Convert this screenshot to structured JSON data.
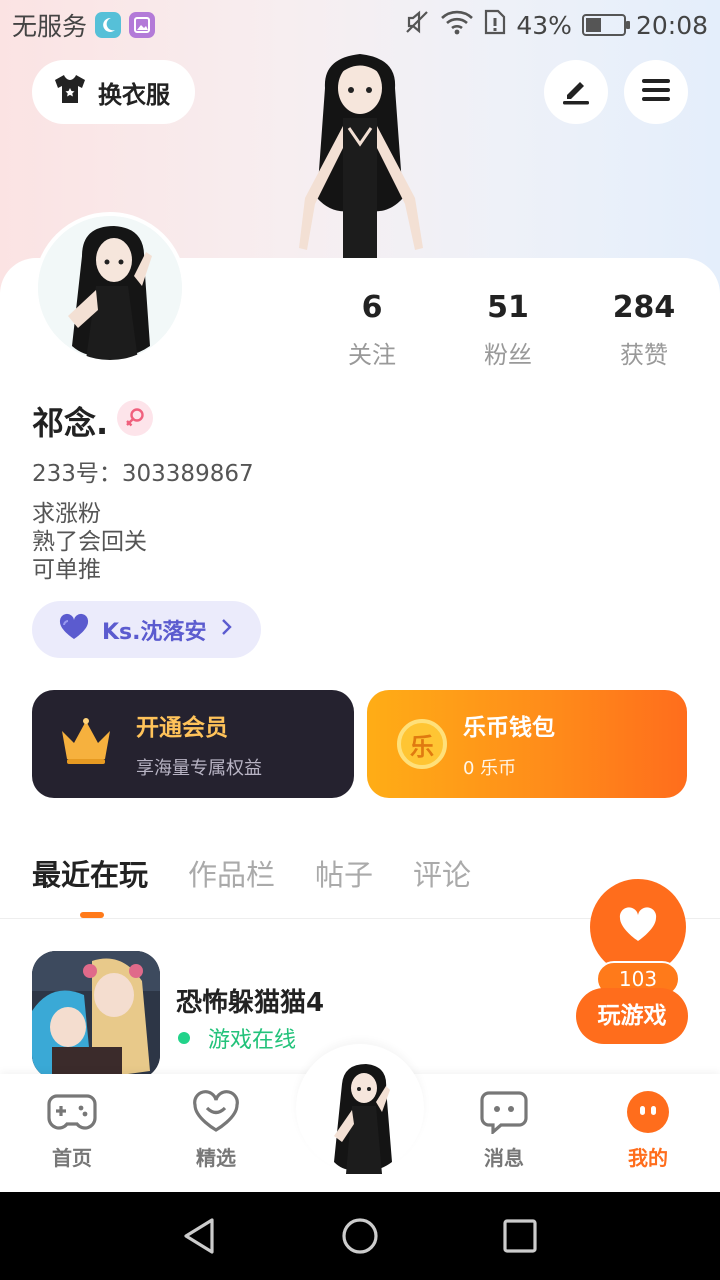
{
  "status_bar": {
    "carrier": "无服务",
    "battery": "43%",
    "battery_level": 0.43,
    "time": "20:08",
    "icons": [
      "moon-icon",
      "image-icon",
      "mute-icon",
      "wifi-icon",
      "sim-alert-icon",
      "battery-icon"
    ]
  },
  "header": {
    "outfit_label": "换衣服",
    "icons": [
      "shirt-icon",
      "edit-icon",
      "menu-icon"
    ]
  },
  "profile": {
    "stats": [
      {
        "value": "6",
        "label": "关注"
      },
      {
        "value": "51",
        "label": "粉丝"
      },
      {
        "value": "284",
        "label": "获赞"
      }
    ],
    "username": "祁念.",
    "uid": "233号：303389867",
    "bio": [
      "求涨粉",
      "熟了会回关",
      "可单推"
    ],
    "fan_chip": "Ks.沈落安"
  },
  "promo": {
    "vip_title": "开通会员",
    "vip_sub": "享海量专属权益",
    "wallet_title": "乐币钱包",
    "wallet_sub": "0 乐币",
    "wallet_icon_char": "乐"
  },
  "tabs": [
    "最近在玩",
    "作品栏",
    "帖子",
    "评论"
  ],
  "recent_game": {
    "name": "恐怖躲猫猫4",
    "status": "游戏在线",
    "like_count": "103",
    "play_label": "玩游戏"
  },
  "bottom_nav": [
    {
      "label": "首页",
      "icon": "gamepad-icon"
    },
    {
      "label": "精选",
      "icon": "heart-smile-icon"
    },
    {
      "label": "消息",
      "icon": "message-icon"
    },
    {
      "label": "我的",
      "icon": "profile-dots-icon"
    }
  ],
  "colors": {
    "accent": "#ff6d1c",
    "online": "#22c27a",
    "vip_bg": "#25222f",
    "vip_text": "#ffc35a"
  }
}
